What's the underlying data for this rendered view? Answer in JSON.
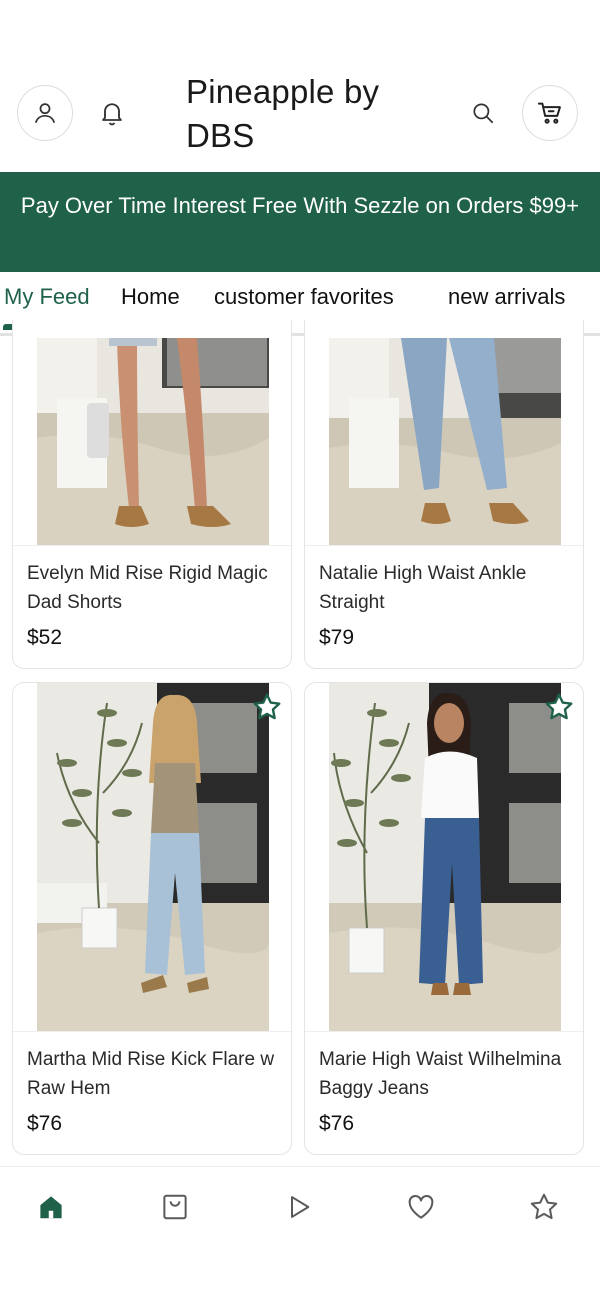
{
  "header": {
    "brand_title": "Pineapple by DBS",
    "icons": [
      "account-icon",
      "bell-icon",
      "search-icon",
      "cart-icon"
    ]
  },
  "banner": {
    "text": "Pay Over Time Interest Free With Sezzle on Orders $99+"
  },
  "tabs": [
    {
      "label": "My Feed",
      "active": true
    },
    {
      "label": "Home",
      "active": false
    },
    {
      "label": "customer favorites",
      "active": false
    },
    {
      "label": "new arrivals",
      "active": false
    }
  ],
  "products": [
    {
      "name": "Evelyn Mid Rise Rigid Magic Dad Shorts",
      "price": "$52",
      "favorited": false
    },
    {
      "name": "Natalie High Waist Ankle Straight",
      "price": "$79",
      "favorited": false
    },
    {
      "name": "Martha Mid Rise Kick Flare w Raw Hem",
      "price": "$76",
      "favorited": true
    },
    {
      "name": "Marie High Waist Wilhelmina Baggy Jeans",
      "price": "$76",
      "favorited": true
    }
  ],
  "bottom_nav": {
    "items": [
      "home-icon",
      "shopping-bag-icon",
      "play-icon",
      "heart-icon",
      "star-icon"
    ],
    "active": "home-icon"
  },
  "colors": {
    "brand_green": "#1f6149",
    "text": "#1f1f1f",
    "icon_gray": "#5a5a5a"
  }
}
